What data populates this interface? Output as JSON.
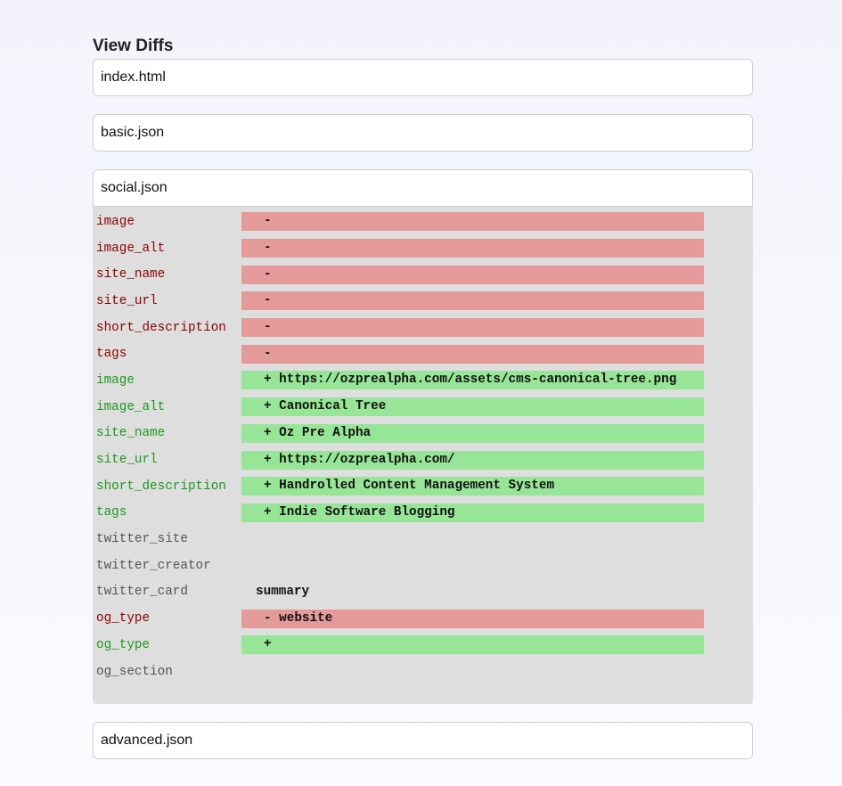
{
  "page": {
    "title": "View Diffs"
  },
  "files": [
    {
      "name": "index.html",
      "expanded": false
    },
    {
      "name": "basic.json",
      "expanded": false
    },
    {
      "name": "social.json",
      "expanded": true
    },
    {
      "name": "advanced.json",
      "expanded": false
    }
  ],
  "social_diff": [
    {
      "key": "image",
      "type": "removed",
      "value": "-"
    },
    {
      "key": "image_alt",
      "type": "removed",
      "value": "-"
    },
    {
      "key": "site_name",
      "type": "removed",
      "value": "-"
    },
    {
      "key": "site_url",
      "type": "removed",
      "value": "-"
    },
    {
      "key": "short_description",
      "type": "removed",
      "value": "-"
    },
    {
      "key": "tags",
      "type": "removed",
      "value": "-"
    },
    {
      "key": "image",
      "type": "added",
      "value": "+ https://ozprealpha.com/assets/cms-canonical-tree.png"
    },
    {
      "key": "image_alt",
      "type": "added",
      "value": "+ Canonical Tree"
    },
    {
      "key": "site_name",
      "type": "added",
      "value": "+ Oz Pre Alpha"
    },
    {
      "key": "site_url",
      "type": "added",
      "value": "+ https://ozprealpha.com/"
    },
    {
      "key": "short_description",
      "type": "added",
      "value": "+ Handrolled Content Management System"
    },
    {
      "key": "tags",
      "type": "added",
      "value": "+ Indie Software Blogging"
    },
    {
      "key": "twitter_site",
      "type": "unchanged",
      "value": ""
    },
    {
      "key": "twitter_creator",
      "type": "unchanged",
      "value": ""
    },
    {
      "key": "twitter_card",
      "type": "unchanged",
      "value": "summary"
    },
    {
      "key": "og_type",
      "type": "removed",
      "value": "- website"
    },
    {
      "key": "og_type",
      "type": "added",
      "value": "+"
    },
    {
      "key": "og_section",
      "type": "unchanged",
      "value": ""
    }
  ],
  "colors": {
    "removed_bg": "#e59a9a",
    "added_bg": "#97e697",
    "removed_key": "#8b0000",
    "added_key": "#1a9a1a",
    "panel_bg": "#dedede"
  }
}
